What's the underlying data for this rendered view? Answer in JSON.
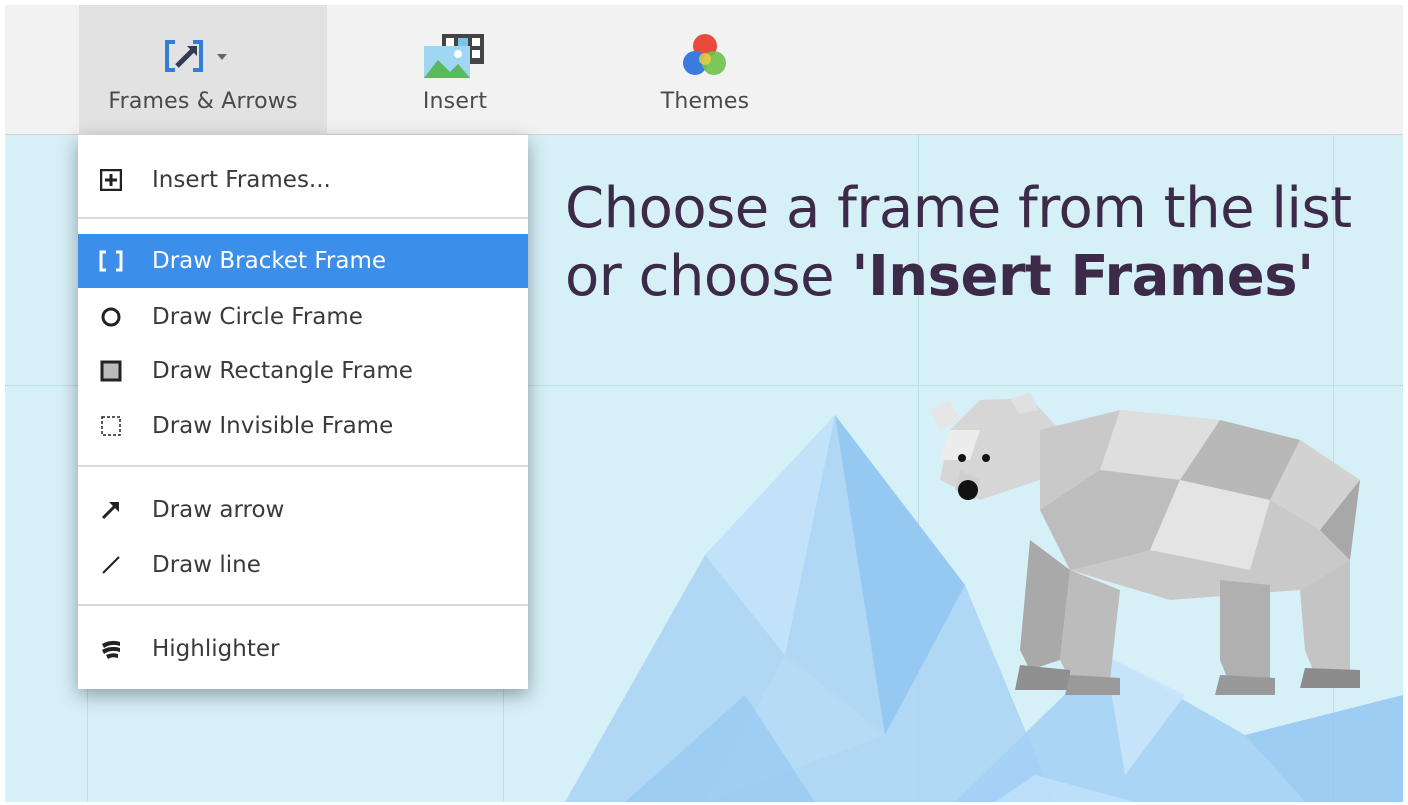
{
  "toolbar": {
    "buttons": [
      {
        "label": "Frames & Arrows",
        "icon": "frames-arrows-icon",
        "active": true
      },
      {
        "label": "Insert",
        "icon": "insert-media-icon",
        "active": false
      },
      {
        "label": "Themes",
        "icon": "themes-icon",
        "active": false
      }
    ]
  },
  "menu": {
    "items": [
      {
        "label": "Insert Frames...",
        "icon": "plus-box-icon"
      },
      {
        "label": "Draw Bracket Frame",
        "icon": "bracket-frame-icon",
        "selected": true
      },
      {
        "label": "Draw Circle Frame",
        "icon": "circle-frame-icon"
      },
      {
        "label": "Draw Rectangle Frame",
        "icon": "rectangle-frame-icon"
      },
      {
        "label": "Draw Invisible Frame",
        "icon": "invisible-frame-icon"
      },
      {
        "label": "Draw arrow",
        "icon": "arrow-icon"
      },
      {
        "label": "Draw line",
        "icon": "line-icon"
      },
      {
        "label": "Highlighter",
        "icon": "highlighter-icon"
      }
    ]
  },
  "canvas": {
    "headline_plain": "Choose a frame from the list or choose ",
    "headline_bold": "'Insert Frames'"
  },
  "colors": {
    "accent": "#3b8eea",
    "headline": "#3c2a48",
    "canvas_bg": "#d6f0f8"
  }
}
